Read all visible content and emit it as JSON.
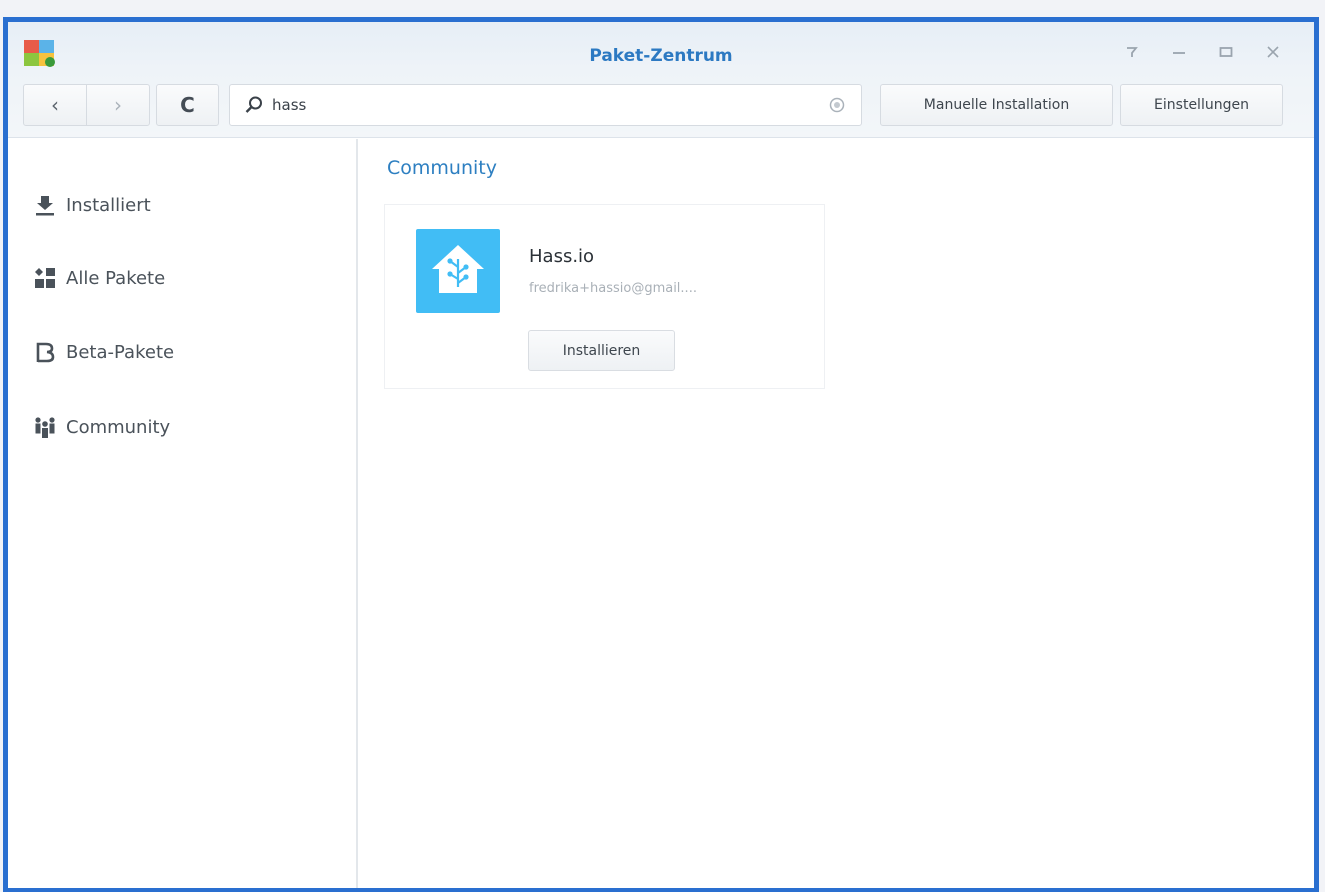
{
  "window": {
    "title": "Paket-Zentrum",
    "controls": [
      "help-icon",
      "minimize-icon",
      "maximize-icon",
      "close-icon"
    ]
  },
  "toolbar": {
    "back_icon": "‹",
    "forward_icon": "›",
    "refresh_icon": "C",
    "search_value": "hass",
    "manual_install_label": "Manuelle Installation",
    "settings_label": "Einstellungen"
  },
  "sidebar": {
    "items": [
      {
        "label": "Installiert",
        "icon": "download-icon"
      },
      {
        "label": "Alle Pakete",
        "icon": "grid-icon"
      },
      {
        "label": "Beta-Pakete",
        "icon": "beta-icon"
      },
      {
        "label": "Community",
        "icon": "community-icon"
      }
    ]
  },
  "main": {
    "section_title": "Community",
    "package": {
      "name": "Hass.io",
      "author": "fredrika+hassio@gmail....",
      "install_label": "Installieren"
    }
  },
  "colors": {
    "window_border": "#2a6fd0",
    "accent": "#2c79c2",
    "package_icon_bg": "#41bdf5"
  }
}
